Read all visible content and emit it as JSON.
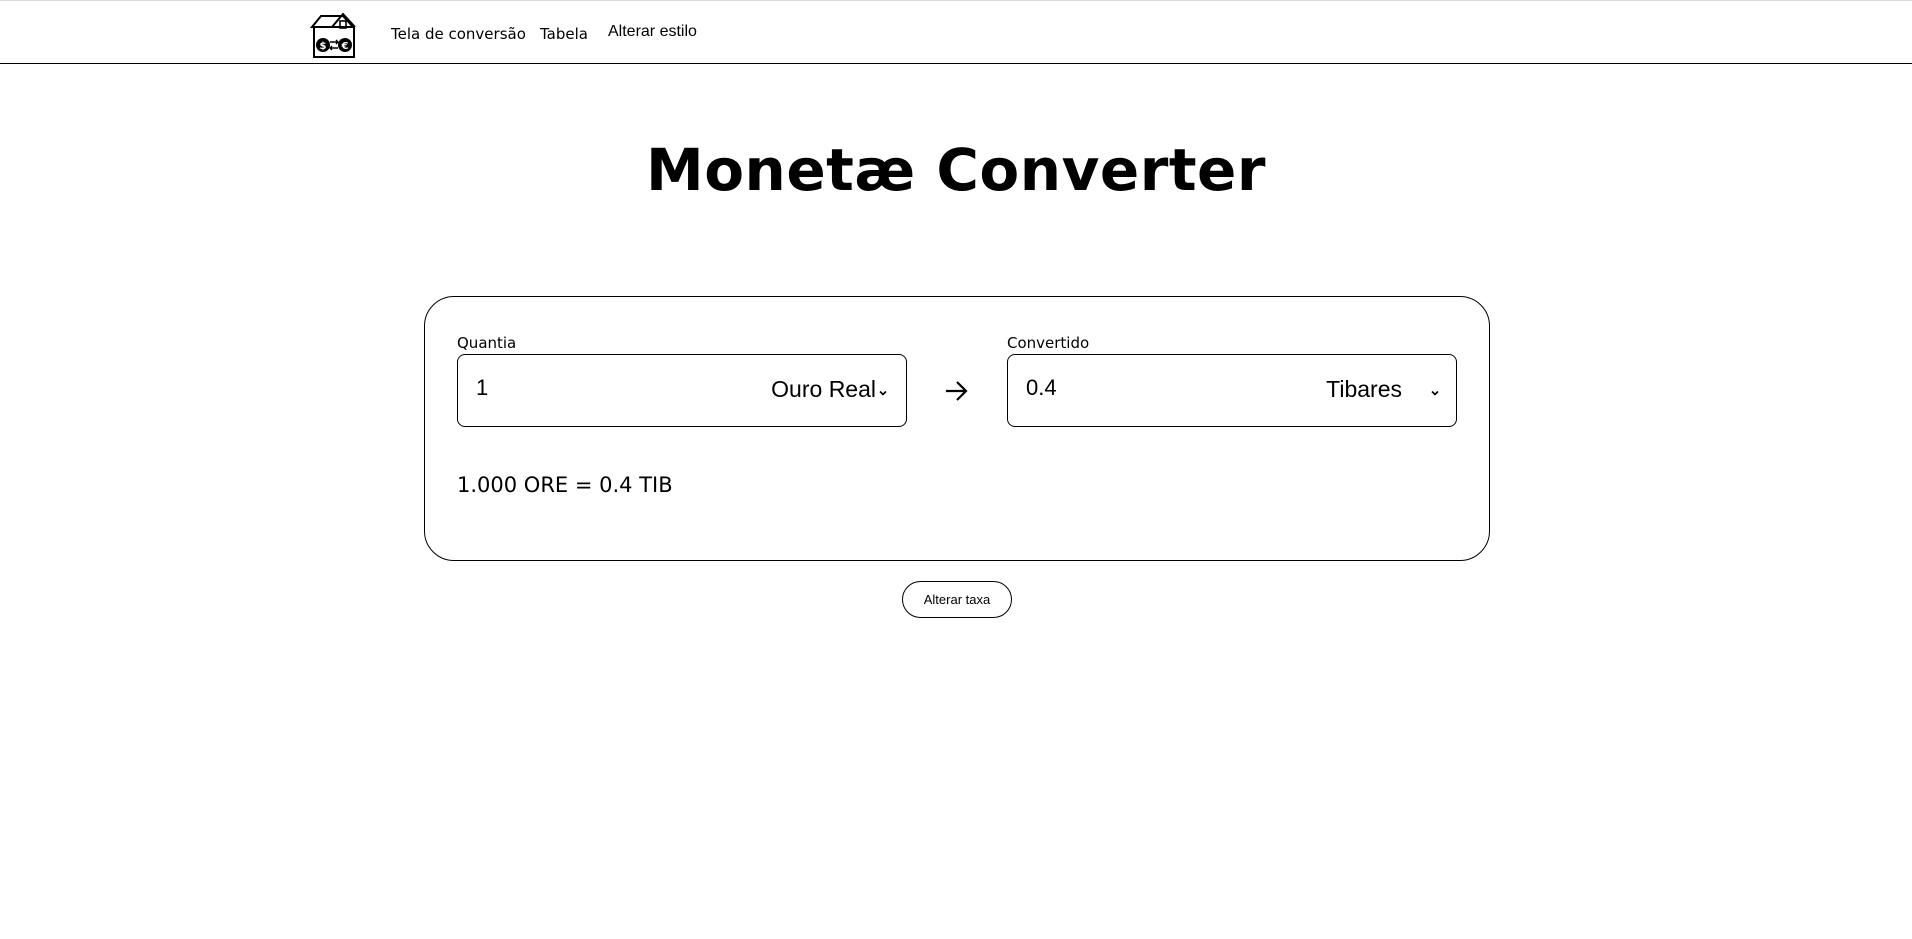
{
  "nav": {
    "logo_icon": "house-currency-exchange-icon",
    "links": [
      "Tela de conversão",
      "Tabela",
      "Alterar estilo"
    ]
  },
  "title": "Monetæ Converter",
  "converter": {
    "amount": {
      "label": "Quantia",
      "value": "1",
      "currency": "Ouro Real"
    },
    "arrow_icon": "arrow-right-icon",
    "converted": {
      "label": "Convertido",
      "value": "0.4",
      "currency": "Tibares"
    },
    "rate_text": "1.000 ORE = 0.4 TIB"
  },
  "alter_rate_button": "Alterar taxa"
}
